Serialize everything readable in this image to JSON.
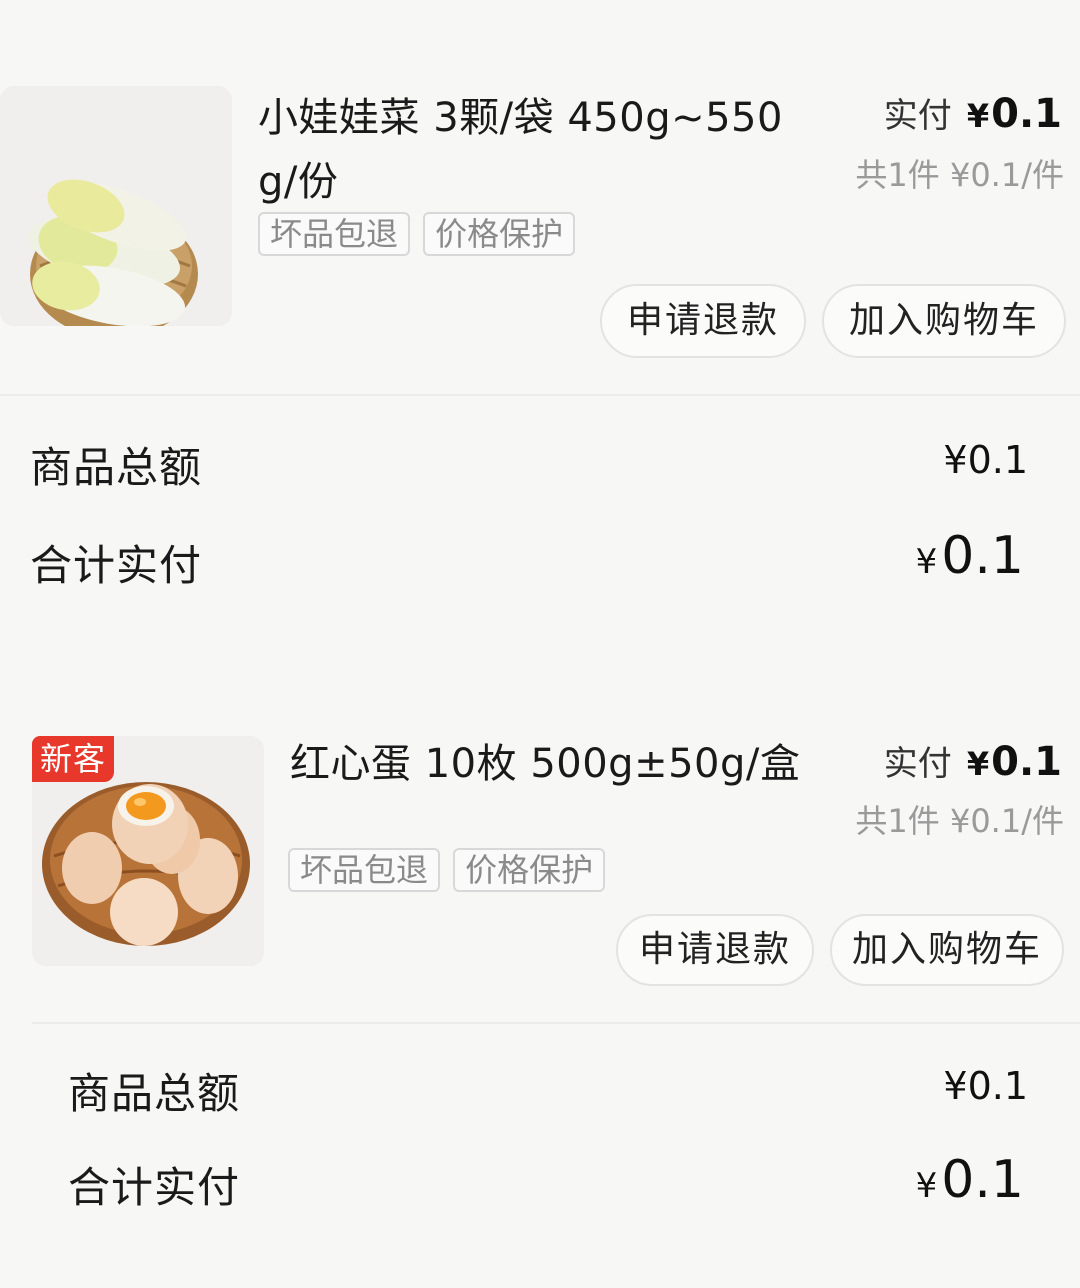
{
  "orders": [
    {
      "product": {
        "title": "小娃娃菜 3颗/袋 450g~550g/份",
        "image": "baby-cabbage-basket",
        "badge": "",
        "tags": [
          "坏品包退",
          "价格保护"
        ]
      },
      "pay_label": "实付",
      "pay_currency": "¥",
      "pay_amount": "0.1",
      "qty_text": "共1件 ¥0.1/件",
      "buttons": {
        "refund": "申请退款",
        "add_cart": "加入购物车"
      },
      "summary": {
        "goods_total_label": "商品总额",
        "goods_total_value": "¥0.1",
        "total_label": "合计实付",
        "total_currency": "¥",
        "total_value": "0.1"
      }
    },
    {
      "product": {
        "title": "红心蛋 10枚 500g±50g/盒",
        "image": "eggs-basket",
        "badge": "新客",
        "tags": [
          "坏品包退",
          "价格保护"
        ]
      },
      "pay_label": "实付",
      "pay_currency": "¥",
      "pay_amount": "0.1",
      "qty_text": "共1件 ¥0.1/件",
      "buttons": {
        "refund": "申请退款",
        "add_cart": "加入购物车"
      },
      "summary": {
        "goods_total_label": "商品总额",
        "goods_total_value": "¥0.1",
        "total_label": "合计实付",
        "total_currency": "¥",
        "total_value": "0.1"
      }
    }
  ],
  "colors": {
    "background": "#f7f7f5",
    "badge": "#e8382c",
    "muted_text": "#9a9a9a",
    "egg_yolk": "#f39a1e"
  }
}
